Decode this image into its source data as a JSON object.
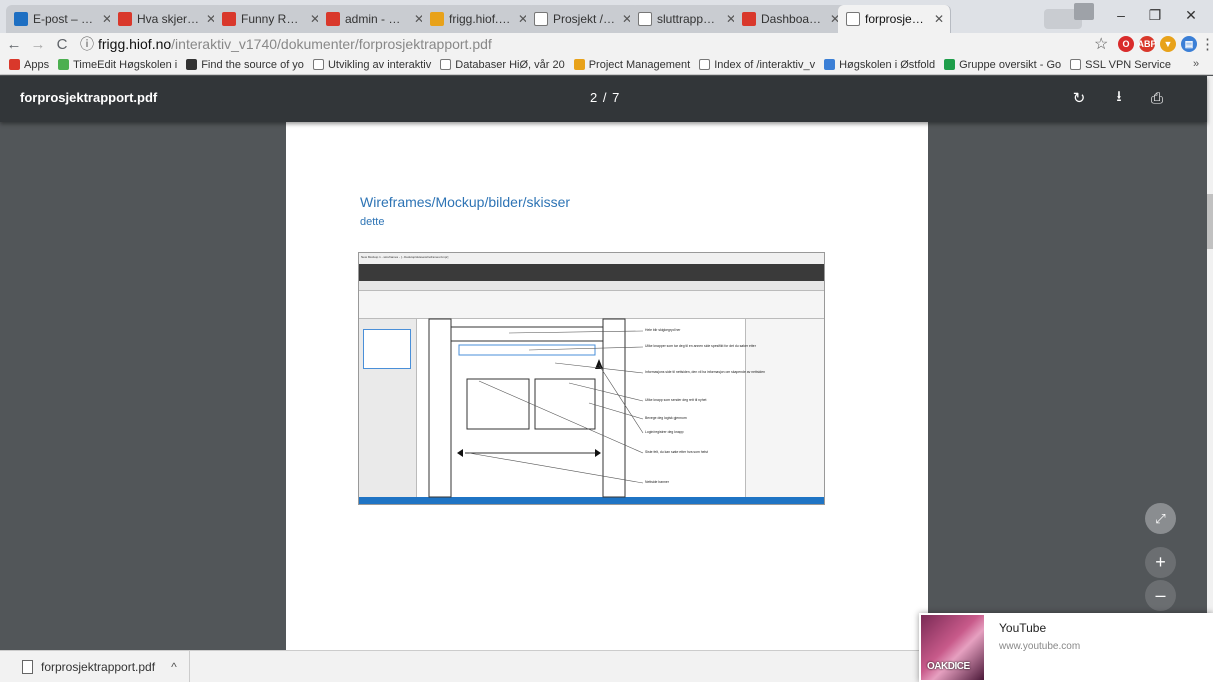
{
  "tabs": [
    {
      "title": "E-post – havard",
      "favicon": "outlook-icon",
      "color": "#1e6fc2"
    },
    {
      "title": "Hva skjer'a? - N",
      "favicon": "hiof-icon",
      "color": "#d9382b"
    },
    {
      "title": "Funny Racist Te",
      "favicon": "youtube-icon",
      "color": "#d9382b"
    },
    {
      "title": "admin - Hva sk",
      "favicon": "hiof-icon",
      "color": "#d9382b"
    },
    {
      "title": "frigg.hiof.no /",
      "favicon": "directory-icon",
      "color": "#e8a21a"
    },
    {
      "title": "Prosjekt / grupp",
      "favicon": "document-icon",
      "color": "#ffffff"
    },
    {
      "title": "sluttrapport.pdf",
      "favicon": "document-icon",
      "color": "#ffffff"
    },
    {
      "title": "Dashboard ‹ Hv",
      "favicon": "hiof-icon",
      "color": "#d9382b"
    },
    {
      "title": "forprosjektrapp",
      "favicon": "document-icon",
      "color": "#ffffff",
      "active": true
    }
  ],
  "window": {
    "minimize": "–",
    "maximize": "❐",
    "close": "✕"
  },
  "address": {
    "info_icon": "ⓘ",
    "host": "frigg.hiof.no",
    "path": "/interaktiv_v1740/dokumenter/forprosjektrapport.pdf",
    "star": "☆"
  },
  "extensions": [
    {
      "name": "opera-icon",
      "label": "O",
      "color": "#d92b2b"
    },
    {
      "name": "adblock-icon",
      "label": "ABP",
      "color": "#d9382b"
    },
    {
      "name": "shield-icon",
      "label": "▼",
      "color": "#e8a21a"
    },
    {
      "name": "extension-icon",
      "label": "▤",
      "color": "#3b7fd6"
    }
  ],
  "menu_icon": "⋮",
  "bookmarks": [
    {
      "label": "Apps",
      "color": "#d9382b"
    },
    {
      "label": "TimeEdit Høgskolen i",
      "color": "#4caf50"
    },
    {
      "label": "Find the source of yo",
      "color": "#333333"
    },
    {
      "label": "Utvikling av interaktiv",
      "color": "#ffffff"
    },
    {
      "label": "Databaser HiØ, vår 20",
      "color": "#ffffff"
    },
    {
      "label": "Project Management",
      "color": "#e8a21a"
    },
    {
      "label": "Index of /interaktiv_v",
      "color": "#ffffff"
    },
    {
      "label": "Høgskolen i Østfold",
      "color": "#3b7fd6"
    },
    {
      "label": "Gruppe oversikt - Go",
      "color": "#1e9e4a"
    },
    {
      "label": "SSL VPN Service",
      "color": "#ffffff"
    }
  ],
  "bookmarks_more": "»",
  "pdf": {
    "filename": "forprosjektrapport.pdf",
    "page_indicator": "2 / 7",
    "rotate": "↻",
    "download": "⭳",
    "print": "⎙",
    "heading": "Wireframes/Mockup/bilder/skisser",
    "subheading": "dette"
  },
  "mockup": {
    "window_title": "New Mockup 1 - wireframes - [...Desktop/skisse/wireframes.bmpr]",
    "annotations": [
      "Hele blir skigkegryd her",
      "Ulike knapper som tar deg til en annen side spesifikt for det du søker etter",
      "Informasjons side til nettsiden, den vil ha informasjon om skapende av nettsiden",
      "Ulike knapp som sender deg rett til nyhet",
      "Bevege deg logisk gjennom",
      "Login/registrer deg knapp",
      "Siste felt, du kan søke etter hva som helst",
      "Nettside banner"
    ]
  },
  "zoom": {
    "fit": "⤢",
    "in": "+",
    "out": "–"
  },
  "notification": {
    "title": "YouTube",
    "url": "www.youtube.com",
    "image_text": "OAKDICE"
  },
  "download_shelf": {
    "filename": "forprosjektrapport.pdf",
    "chevron": "^"
  }
}
